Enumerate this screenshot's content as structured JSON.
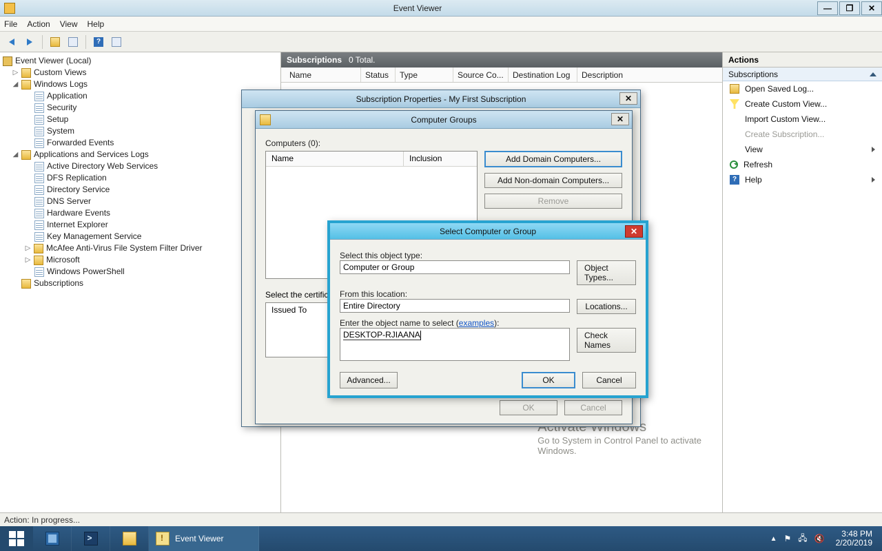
{
  "window": {
    "title": "Event Viewer",
    "min": "—",
    "max": "❐",
    "close": "✕"
  },
  "menu": {
    "file": "File",
    "action": "Action",
    "view": "View",
    "help": "Help"
  },
  "tree": {
    "root": "Event Viewer (Local)",
    "custom_views": "Custom Views",
    "windows_logs": "Windows Logs",
    "wl_items": [
      "Application",
      "Security",
      "Setup",
      "System",
      "Forwarded Events"
    ],
    "apps_services": "Applications and Services Logs",
    "as_items": [
      "Active Directory Web Services",
      "DFS Replication",
      "Directory Service",
      "DNS Server",
      "Hardware Events",
      "Internet Explorer",
      "Key Management Service",
      "McAfee Anti-Virus File System Filter Driver",
      "Microsoft",
      "Windows PowerShell"
    ],
    "subscriptions": "Subscriptions"
  },
  "center": {
    "hdr_title": "Subscriptions",
    "hdr_total": "0 Total.",
    "cols": [
      "Name",
      "Status",
      "Type",
      "Source Co...",
      "Destination Log",
      "Description"
    ]
  },
  "actions": {
    "title": "Actions",
    "section": "Subscriptions",
    "open": "Open Saved Log...",
    "create_custom": "Create Custom View...",
    "import_custom": "Import Custom View...",
    "create_sub": "Create Subscription...",
    "view": "View",
    "refresh": "Refresh",
    "help": "Help"
  },
  "dlg_subprops": {
    "title": "Subscription Properties - My First Subscription"
  },
  "dlg_cg": {
    "title": "Computer Groups",
    "computers_label": "Computers (0):",
    "col_name": "Name",
    "col_inc": "Inclusion",
    "btn_add_domain": "Add Domain Computers...",
    "btn_add_nondomain": "Add Non-domain Computers...",
    "btn_remove": "Remove",
    "cert_label": "Select the certificate",
    "cert_col": "Issued To",
    "ok": "OK",
    "cancel": "Cancel"
  },
  "dlg_select": {
    "title": "Select Computer or Group",
    "obj_type_label": "Select this object type:",
    "obj_type_value": "Computer or Group",
    "btn_obj_types": "Object Types...",
    "loc_label": "From this location:",
    "loc_value": "Entire Directory",
    "btn_locations": "Locations...",
    "name_label_pre": "Enter the object name to select (",
    "name_label_link": "examples",
    "name_label_post": "):",
    "name_value": "DESKTOP-RJIAANA",
    "btn_check": "Check Names",
    "btn_advanced": "Advanced...",
    "ok": "OK",
    "cancel": "Cancel"
  },
  "statusbar": {
    "text": "Action:  In progress..."
  },
  "taskbar": {
    "active_app": "Event Viewer",
    "time": "3:48 PM",
    "date": "2/20/2019"
  },
  "watermark": {
    "h": "Activate Windows",
    "s1": "Go to System in Control Panel to activate",
    "s2": "Windows."
  }
}
